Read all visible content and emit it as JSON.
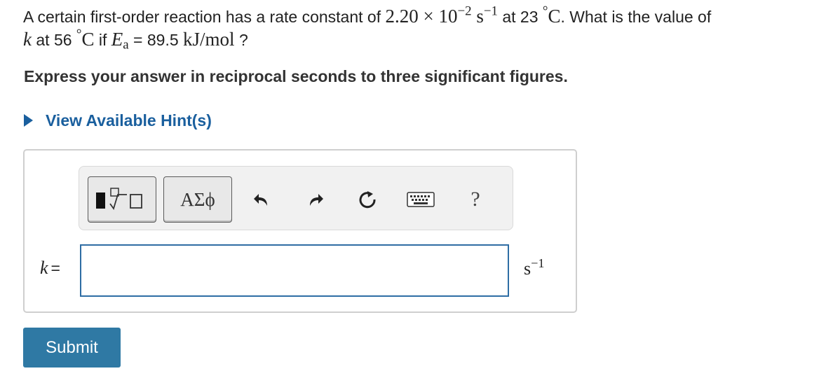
{
  "question": {
    "t1": "A certain first-order reaction has a rate constant of ",
    "k_coeff": "2.20",
    "times": " × ",
    "base": "10",
    "exp": "−2",
    "unit_s": "s",
    "unit_exp": "−1",
    "t2": " at 23 ",
    "deg": "°",
    "C": "C",
    "t3": ". What is the value of",
    "k": "k",
    "t4": " at 56 ",
    "t5": " if ",
    "E": "E",
    "E_sub": "a",
    "t6": " = 89.5 ",
    "Ea_unit": "kJ/mol",
    "t7": " ?"
  },
  "instruction": "Express your answer in reciprocal seconds to three significant figures.",
  "hint": {
    "label": "View Available Hint(s)"
  },
  "toolbar": {
    "symbols_label": "ΑΣϕ",
    "help_label": "?"
  },
  "answer": {
    "variable": "k",
    "equals": "=",
    "value": "",
    "unit": "s",
    "unit_exp": "−1"
  },
  "submit_label": "Submit",
  "colors": {
    "link": "#1a5f9e",
    "submit": "#2f79a4",
    "input_border": "#2e6da4"
  }
}
